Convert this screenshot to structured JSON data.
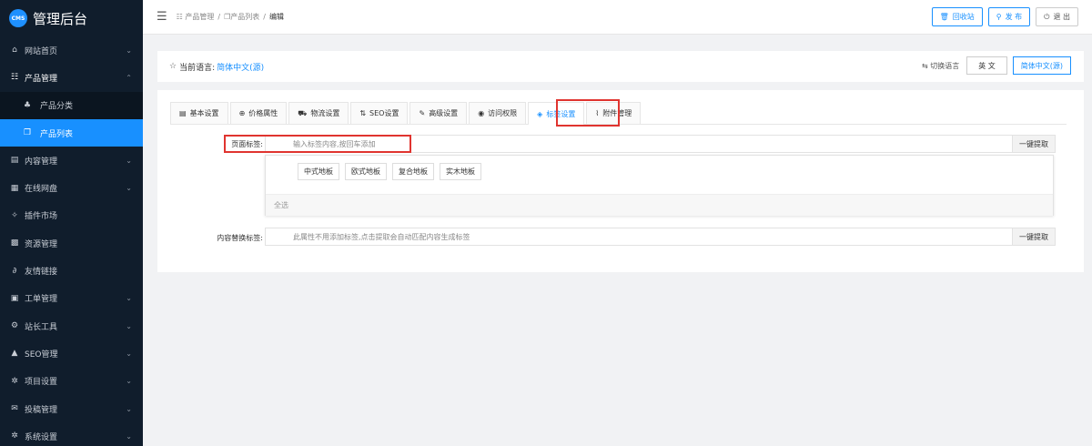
{
  "app": {
    "logo_badge": "CMS",
    "title": "管理后台"
  },
  "sidebar": {
    "items": [
      {
        "icon": "home-icon",
        "glyph": "⌂",
        "label": "网站首页",
        "chevron": "⌄"
      },
      {
        "icon": "product-icon",
        "glyph": "☷",
        "label": "产品管理",
        "chevron": "⌃"
      },
      {
        "icon": "category-icon",
        "glyph": "♣",
        "label": "产品分类"
      },
      {
        "icon": "list-icon",
        "glyph": "❐",
        "label": "产品列表"
      },
      {
        "icon": "content-icon",
        "glyph": "▤",
        "label": "内容管理",
        "chevron": "⌄"
      },
      {
        "icon": "disk-icon",
        "glyph": "▦",
        "label": "在线网盘",
        "chevron": "⌄"
      },
      {
        "icon": "plugin-icon",
        "glyph": "✧",
        "label": "插件市场"
      },
      {
        "icon": "resource-icon",
        "glyph": "▩",
        "label": "资源管理"
      },
      {
        "icon": "link-icon",
        "glyph": "∂",
        "label": "友情链接"
      },
      {
        "icon": "ticket-icon",
        "glyph": "▣",
        "label": "工单管理",
        "chevron": "⌄"
      },
      {
        "icon": "tools-icon",
        "glyph": "⚙",
        "label": "站长工具",
        "chevron": "⌄"
      },
      {
        "icon": "seo-icon",
        "glyph": "▲",
        "label": "SEO管理",
        "chevron": "⌄"
      },
      {
        "icon": "project-icon",
        "glyph": "✲",
        "label": "项目设置",
        "chevron": "⌄"
      },
      {
        "icon": "mail-icon",
        "glyph": "✉",
        "label": "投稿管理",
        "chevron": "⌄"
      },
      {
        "icon": "system-icon",
        "glyph": "✲",
        "label": "系统设置",
        "chevron": "⌄"
      }
    ]
  },
  "header": {
    "menu_glyph": "☰",
    "breadcrumb": [
      {
        "glyph": "☷",
        "label": "产品管理"
      },
      {
        "sep": "/"
      },
      {
        "glyph": "❐",
        "label": "产品列表"
      },
      {
        "sep2": "/"
      },
      {
        "current": "编辑"
      }
    ],
    "crumb_1": "☷ 产品管理",
    "sep": "/",
    "crumb_2": "❐产品列表",
    "crumb_3": "编辑",
    "recycle": {
      "glyph": "🗑",
      "label": "回收站"
    },
    "publish": {
      "glyph": "⚲",
      "label": "发 布"
    },
    "logout": {
      "glyph": "⏻",
      "label": "退 出"
    }
  },
  "language": {
    "star": "☆",
    "label": "当前语言:",
    "current": "简体中文(源)",
    "switch_glyph": "⇆",
    "switch_label": "切换语言",
    "options": [
      "英 文",
      "简体中文(源)"
    ]
  },
  "tabs": [
    {
      "glyph": "▤",
      "label": "基本设置"
    },
    {
      "glyph": "⊕",
      "label": "价格属性"
    },
    {
      "glyph": "⛟",
      "label": "物流设置"
    },
    {
      "glyph": "⇅",
      "label": "SEO设置"
    },
    {
      "glyph": "✎",
      "label": "高级设置"
    },
    {
      "glyph": "◉",
      "label": "访问权限"
    },
    {
      "glyph": "◈",
      "label": "标签设置",
      "active": true
    },
    {
      "glyph": "⌇",
      "label": "附件管理"
    }
  ],
  "form": {
    "page_tags": {
      "label": "页面标签:",
      "placeholder": "输入标签内容,按回车添加",
      "addon": "一键提取",
      "suggestions": [
        "中式地板",
        "欧式地板",
        "复合地板",
        "实木地板"
      ],
      "select_all": "全选"
    },
    "replace_tags": {
      "label": "内容替换标签:",
      "placeholder": "此属性不用添加标签,点击提取会自动匹配内容生成标签",
      "addon": "一键提取"
    }
  },
  "colors": {
    "sidebar_bg": "#101d2c",
    "accent": "#1890ff",
    "highlight": "#e0342f"
  }
}
